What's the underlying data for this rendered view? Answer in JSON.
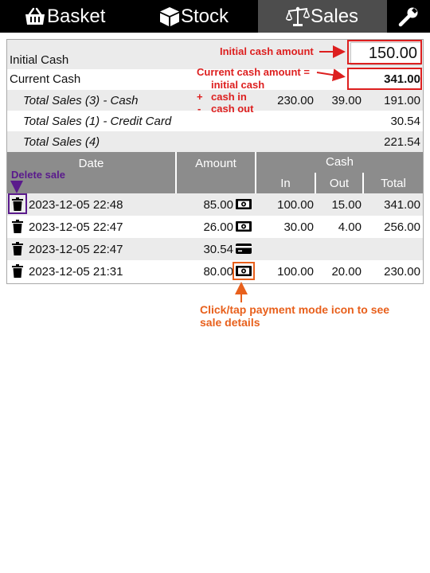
{
  "nav": {
    "basket": "Basket",
    "stock": "Stock",
    "sales": "Sales"
  },
  "summary": {
    "initial_cash_label": "Initial Cash",
    "initial_cash_value": "150.00",
    "current_cash_label": "Current Cash",
    "current_cash_value": "341.00",
    "total_cash_label": "Total Sales (3) - Cash",
    "total_cash_in": "230.00",
    "total_cash_out": "39.00",
    "total_cash_total": "191.00",
    "total_card_label": "Total Sales (1) - Credit Card",
    "total_card_total": "30.54",
    "total_label": "Total Sales (4)",
    "total_total": "221.54"
  },
  "table": {
    "headers": {
      "date": "Date",
      "amount": "Amount",
      "cash": "Cash",
      "in": "In",
      "out": "Out",
      "total": "Total"
    },
    "rows": [
      {
        "date": "2023-12-05 22:48",
        "amount": "85.00",
        "pay": "cash",
        "in": "100.00",
        "out": "15.00",
        "total": "341.00"
      },
      {
        "date": "2023-12-05 22:47",
        "amount": "26.00",
        "pay": "cash",
        "in": "30.00",
        "out": "4.00",
        "total": "256.00"
      },
      {
        "date": "2023-12-05 22:47",
        "amount": "30.54",
        "pay": "card",
        "in": "",
        "out": "",
        "total": ""
      },
      {
        "date": "2023-12-05 21:31",
        "amount": "80.00",
        "pay": "cash",
        "in": "100.00",
        "out": "20.00",
        "total": "230.00"
      }
    ]
  },
  "annotations": {
    "initial_cash": "Initial cash amount",
    "current_cash_1": "Current cash amount =",
    "current_cash_2": "initial cash",
    "current_cash_3_sign": "+",
    "current_cash_3": "cash in",
    "current_cash_4_sign": "-",
    "current_cash_4": "cash out",
    "delete_sale": "Delete sale",
    "payment_icon_1": "Click/tap payment mode icon to see",
    "payment_icon_2": "sale details"
  },
  "colors": {
    "annotation_red": "#dd1f1f",
    "annotation_purple": "#5a1a8c",
    "annotation_orange": "#e8601c",
    "header_gray": "#8c8c8c",
    "row_alt": "#ebebeb",
    "nav_active": "#4d4d4d"
  }
}
